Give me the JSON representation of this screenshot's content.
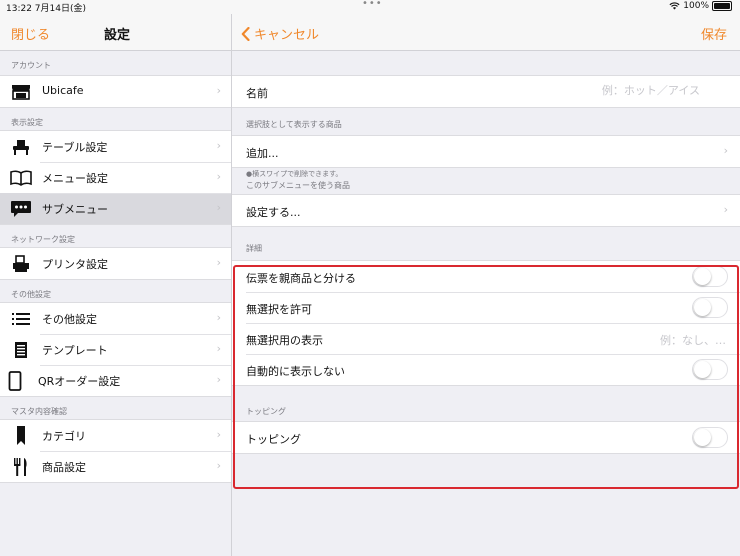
{
  "statusbar": {
    "time": "13:22  7月14日(金)",
    "dots": "•••",
    "battery": "100%"
  },
  "left": {
    "close": "閉じる",
    "title": "設定",
    "sections": [
      {
        "header": "アカウント",
        "items": [
          {
            "label": "Ubicafe",
            "icon": "store-icon",
            "selected": false
          }
        ]
      },
      {
        "header": "表示設定",
        "items": [
          {
            "label": "テーブル設定",
            "icon": "table-icon",
            "selected": false
          },
          {
            "label": "メニュー設定",
            "icon": "book-icon",
            "selected": false
          },
          {
            "label": "サブメニュー",
            "icon": "chat-dots-icon",
            "selected": true
          }
        ]
      },
      {
        "header": "ネットワーク設定",
        "items": [
          {
            "label": "プリンタ設定",
            "icon": "printer-icon",
            "selected": false
          }
        ]
      },
      {
        "header": "その他設定",
        "items": [
          {
            "label": "その他設定",
            "icon": "list-icon",
            "selected": false
          },
          {
            "label": "テンプレート",
            "icon": "document-icon",
            "selected": false
          },
          {
            "label": "QRオーダー設定",
            "icon": "tablet-icon",
            "selected": false
          }
        ]
      },
      {
        "header": "マスタ内容確認",
        "items": [
          {
            "label": "カテゴリ",
            "icon": "bookmark-icon",
            "selected": false
          },
          {
            "label": "商品設定",
            "icon": "fork-knife-icon",
            "selected": false
          }
        ]
      }
    ],
    "chevron": "›"
  },
  "right": {
    "cancel": "キャンセル",
    "save": "保存",
    "name_label": "名前",
    "name_placeholder": "例：ホット／アイス",
    "choices_header": "選択肢として表示する商品",
    "add_label": "追加...",
    "swipe_note": "●横スワイプで削除できます。",
    "uses_header": "このサブメニューを使う商品",
    "set_label": "設定する...",
    "detail_header": "詳細",
    "separate_label": "伝票を親商品と分ける",
    "allow_none_label": "無選択を許可",
    "none_display_label": "無選択用の表示",
    "none_display_placeholder": "例：なし、…",
    "auto_hide_label": "自動的に表示しない",
    "topping_header": "トッピング",
    "topping_label": "トッピング",
    "toggles": {
      "separate": false,
      "allow_none": false,
      "auto_hide": false,
      "topping": false
    }
  },
  "colors": {
    "accent": "#f0882c",
    "highlight": "#d9282f",
    "background": "#efeff4"
  }
}
